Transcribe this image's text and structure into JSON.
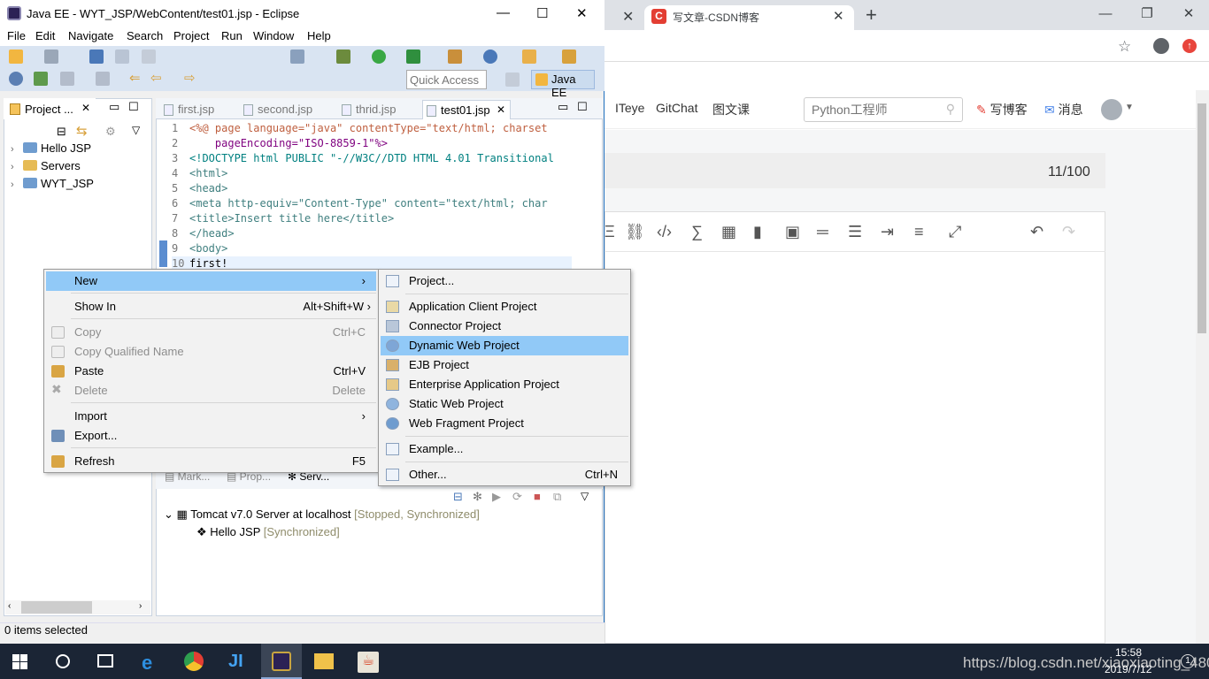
{
  "chrome": {
    "tab_prev_close": "✕",
    "tab_title": "写文章-CSDN博客",
    "tab_close": "✕",
    "new_tab": "+",
    "win_min": "—",
    "win_restore": "❐",
    "win_close": "✕",
    "nav_links": [
      "ITeye",
      "GitChat",
      "图文课"
    ],
    "search_placeholder": "Python工程师",
    "write_blog": "写博客",
    "messages": "消息",
    "word_count": "11/100"
  },
  "eclipse": {
    "title": "Java EE - WYT_JSP/WebContent/test01.jsp - Eclipse",
    "menu": [
      "File",
      "Edit",
      "Navigate",
      "Search",
      "Project",
      "Run",
      "Window",
      "Help"
    ],
    "quick_access": "Quick Access",
    "perspective": "Java EE",
    "project_explorer_tab": "Project ...",
    "projects": [
      {
        "name": "Hello JSP"
      },
      {
        "name": "Servers"
      },
      {
        "name": "WYT_JSP"
      }
    ],
    "editor_tabs": [
      "first.jsp",
      "second.jsp",
      "thrid.jsp",
      "test01.jsp"
    ],
    "code_lines": [
      {
        "n": "1",
        "text": "<%@ page language=\"java\" contentType=\"text/html; charset"
      },
      {
        "n": "2",
        "text": "    pageEncoding=\"ISO-8859-1\"%>"
      },
      {
        "n": "3",
        "text": "<!DOCTYPE html PUBLIC \"-//W3C//DTD HTML 4.01 Transitional"
      },
      {
        "n": "4",
        "text": "<html>"
      },
      {
        "n": "5",
        "text": "<head>"
      },
      {
        "n": "6",
        "text": "<meta http-equiv=\"Content-Type\" content=\"text/html; char"
      },
      {
        "n": "7",
        "text": "<title>Insert title here</title>"
      },
      {
        "n": "8",
        "text": "</head>"
      },
      {
        "n": "9",
        "text": "<body>"
      },
      {
        "n": "10",
        "text": "first!"
      }
    ],
    "bottom_tabs": [
      "Mark...",
      "Prop...",
      "Serv..."
    ],
    "server_name": "Tomcat v7.0 Server at localhost",
    "server_status": "[Stopped, Synchronized]",
    "server_child": "Hello JSP",
    "server_child_status": "[Synchronized]",
    "status_text": "0 items selected"
  },
  "context_menu": {
    "items": [
      {
        "label": "New",
        "shortcut": "›"
      },
      {
        "label": "Show In",
        "shortcut": "Alt+Shift+W ›"
      },
      {
        "label": "Copy",
        "shortcut": "Ctrl+C"
      },
      {
        "label": "Copy Qualified Name",
        "shortcut": ""
      },
      {
        "label": "Paste",
        "shortcut": "Ctrl+V"
      },
      {
        "label": "Delete",
        "shortcut": "Delete"
      },
      {
        "label": "Import",
        "shortcut": "›"
      },
      {
        "label": "Export...",
        "shortcut": ""
      },
      {
        "label": "Refresh",
        "shortcut": "F5"
      }
    ]
  },
  "submenu": {
    "items": [
      {
        "label": "Project...",
        "shortcut": ""
      },
      {
        "label": "Application Client Project",
        "shortcut": ""
      },
      {
        "label": "Connector Project",
        "shortcut": ""
      },
      {
        "label": "Dynamic Web Project",
        "shortcut": ""
      },
      {
        "label": "EJB Project",
        "shortcut": ""
      },
      {
        "label": "Enterprise Application Project",
        "shortcut": ""
      },
      {
        "label": "Static Web Project",
        "shortcut": ""
      },
      {
        "label": "Web Fragment Project",
        "shortcut": ""
      },
      {
        "label": "Example...",
        "shortcut": ""
      },
      {
        "label": "Other...",
        "shortcut": "Ctrl+N"
      }
    ]
  },
  "taskbar": {
    "time": "15:58",
    "date": "2019/7/12",
    "watermark": "https://blog.csdn.net/xiaoxiaoting_4800"
  }
}
